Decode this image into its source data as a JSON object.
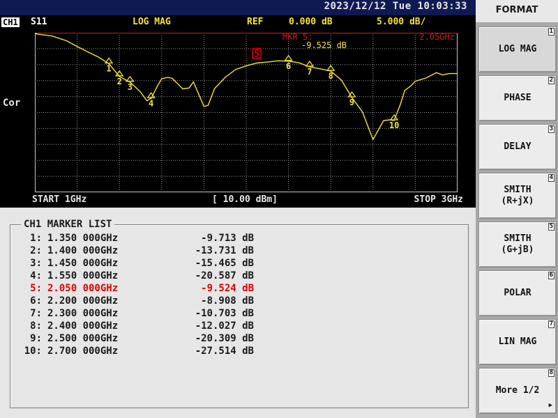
{
  "header": {
    "datetime": "2023/12/12  Tue  10:03:33"
  },
  "display": {
    "channel": "CH1",
    "parameter": "S11",
    "format": "LOG MAG",
    "ref_label": "REF",
    "ref_value": "0.000 dB",
    "scale": "5.000 dB/",
    "correction": "Cor",
    "marker_readout": {
      "label": "MKR  5:",
      "freq": "2.05GHz",
      "value": "-9.525 dB"
    },
    "start": "START 1GHz",
    "power": "[ 10.00 dBm]",
    "stop": "STOP 3GHz",
    "colors": {
      "trace": "#f5e43a",
      "reference_line": "#c81e1e",
      "grid": "#9a9a9a",
      "active_marker": "#e00000"
    }
  },
  "chart_data": {
    "type": "line",
    "xlabel": "",
    "ylabel": "",
    "xlim": [
      1.0,
      3.0
    ],
    "ylim": [
      -50,
      0
    ],
    "reference_level": 0,
    "grid": true,
    "series": [
      {
        "x": [
          1.0,
          1.08,
          1.15,
          1.2,
          1.25,
          1.3,
          1.35,
          1.4,
          1.45,
          1.48,
          1.5,
          1.53,
          1.55,
          1.58,
          1.6,
          1.63,
          1.65,
          1.7,
          1.73,
          1.75,
          1.8,
          1.82,
          1.85,
          1.9,
          1.95,
          2.0,
          2.05,
          2.1,
          2.15,
          2.2,
          2.25,
          2.3,
          2.35,
          2.4,
          2.45,
          2.5,
          2.55,
          2.6,
          2.65,
          2.68,
          2.7,
          2.73,
          2.75,
          2.78,
          2.8,
          2.85,
          2.9,
          2.93,
          2.96,
          3.0
        ],
        "y": [
          -0.3,
          -1.0,
          -2.5,
          -4.3,
          -6.0,
          -7.6,
          -9.7,
          -13.7,
          -15.5,
          -17.3,
          -18.6,
          -21.3,
          -20.6,
          -16.7,
          -14.4,
          -14.0,
          -14.3,
          -17.6,
          -17.3,
          -15.4,
          -23.1,
          -22.7,
          -17.5,
          -14.0,
          -11.5,
          -10.4,
          -9.5,
          -9.2,
          -8.8,
          -8.9,
          -9.4,
          -10.7,
          -11.3,
          -12.0,
          -14.8,
          -20.3,
          -24.8,
          -33.5,
          -27.5,
          -27.3,
          -27.5,
          -22.3,
          -18.1,
          -16.6,
          -15.2,
          -14.2,
          -12.5,
          -13.2,
          -12.8,
          -12.8
        ]
      }
    ],
    "markers": [
      {
        "id": "1",
        "x": 1.35,
        "y": -9.713,
        "active": false
      },
      {
        "id": "2",
        "x": 1.4,
        "y": -13.731,
        "active": false
      },
      {
        "id": "3",
        "x": 1.45,
        "y": -15.465,
        "active": false
      },
      {
        "id": "4",
        "x": 1.55,
        "y": -20.587,
        "active": false
      },
      {
        "id": "5",
        "x": 2.05,
        "y": -9.524,
        "active": true
      },
      {
        "id": "6",
        "x": 2.2,
        "y": -8.908,
        "active": false
      },
      {
        "id": "7",
        "x": 2.3,
        "y": -10.703,
        "active": false
      },
      {
        "id": "8",
        "x": 2.4,
        "y": -12.027,
        "active": false
      },
      {
        "id": "9",
        "x": 2.5,
        "y": -20.309,
        "active": false
      },
      {
        "id": "10",
        "x": 2.7,
        "y": -27.514,
        "active": false
      }
    ]
  },
  "marker_list": {
    "title": "CH1 MARKER LIST",
    "rows": [
      {
        "num": "1:",
        "freq": "1.350 000GHz",
        "value": "-9.713 dB",
        "active": false
      },
      {
        "num": "2:",
        "freq": "1.400 000GHz",
        "value": "-13.731 dB",
        "active": false
      },
      {
        "num": "3:",
        "freq": "1.450 000GHz",
        "value": "-15.465 dB",
        "active": false
      },
      {
        "num": "4:",
        "freq": "1.550 000GHz",
        "value": "-20.587 dB",
        "active": false
      },
      {
        "num": "5:",
        "freq": "2.050 000GHz",
        "value": "-9.524 dB",
        "active": true
      },
      {
        "num": "6:",
        "freq": "2.200 000GHz",
        "value": "-8.908 dB",
        "active": false
      },
      {
        "num": "7:",
        "freq": "2.300 000GHz",
        "value": "-10.703 dB",
        "active": false
      },
      {
        "num": "8:",
        "freq": "2.400 000GHz",
        "value": "-12.027 dB",
        "active": false
      },
      {
        "num": "9:",
        "freq": "2.500 000GHz",
        "value": "-20.309 dB",
        "active": false
      },
      {
        "num": "10:",
        "freq": "2.700 000GHz",
        "value": "-27.514 dB",
        "active": false
      }
    ]
  },
  "softkeys": {
    "title": "FORMAT",
    "keys": [
      {
        "label": "LOG MAG",
        "num": "1",
        "selected": true
      },
      {
        "label": "PHASE",
        "num": "2",
        "selected": false
      },
      {
        "label": "DELAY",
        "num": "3",
        "selected": false
      },
      {
        "label": "SMITH\n(R+jX)",
        "num": "4",
        "selected": false
      },
      {
        "label": "SMITH\n(G+jB)",
        "num": "5",
        "selected": false
      },
      {
        "label": "POLAR",
        "num": "6",
        "selected": false
      },
      {
        "label": "LIN MAG",
        "num": "7",
        "selected": false
      },
      {
        "label": "More 1/2",
        "num": "8",
        "selected": false,
        "arrow": "▶"
      }
    ]
  }
}
